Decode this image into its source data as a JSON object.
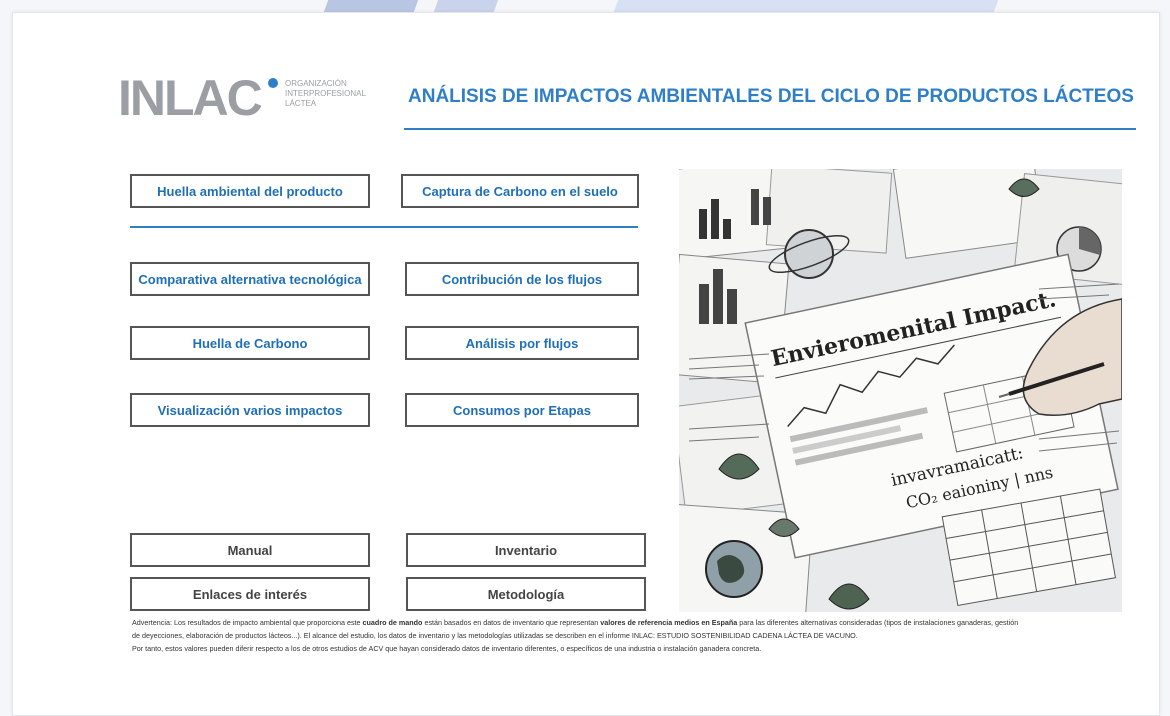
{
  "logo": {
    "wordmark": "INLAC",
    "subline_1": "ORGANIZACIÓN",
    "subline_2": "INTERPROFESIONAL",
    "subline_3": "LÁCTEA"
  },
  "header": {
    "title": "ANÁLISIS DE IMPACTOS AMBIENTALES DEL CICLO DE PRODUCTOS LÁCTEOS"
  },
  "buttons": {
    "huella_ambiental": "Huella ambiental del producto",
    "captura_carbono": "Captura de Carbono en el suelo",
    "comparativa": "Comparativa alternativa tecnológica",
    "contribucion": "Contribución de los flujos",
    "huella_carbono": "Huella de Carbono",
    "analisis_flujos": "Análisis por flujos",
    "visualizacion": "Visualización varios impactos",
    "consumos": "Consumos por Etapas",
    "manual": "Manual",
    "inventario": "Inventario",
    "enlaces": "Enlaces de interés",
    "metodologia": "Metodología"
  },
  "hero": {
    "headline": "Envieromenital Impact",
    "sub": "invavramaicatt:",
    "formula": "CO₂ eaioniny | nns"
  },
  "warning": {
    "p1_a": "Advertencia: Los resultados de impacto ambiental que proporciona este ",
    "p1_b": "cuadro de mando",
    "p1_c": " están basados en datos de inventario que representan ",
    "p1_d": "valores de referencia medios en España",
    "p1_e": " para las diferentes alternativas consideradas (tipos de instalaciones ganaderas, gestión",
    "p2": "de deyecciones, elaboración de productos lácteos...). El alcance del estudio, los datos de inventario y las metodologías utilizadas se describen en el informe INLAC: ESTUDIO SOSTENIBILIDAD CADENA LÁCTEA DE VACUNO.",
    "p3": "Por tanto, estos valores pueden diferir respecto a los de otros estudios de ACV que hayan considerado datos de inventario diferentes, o específicos de una industria o instalación ganadera concreta."
  },
  "colors": {
    "accent": "#2f7fc8",
    "logo_grey": "#9b9ea3"
  }
}
